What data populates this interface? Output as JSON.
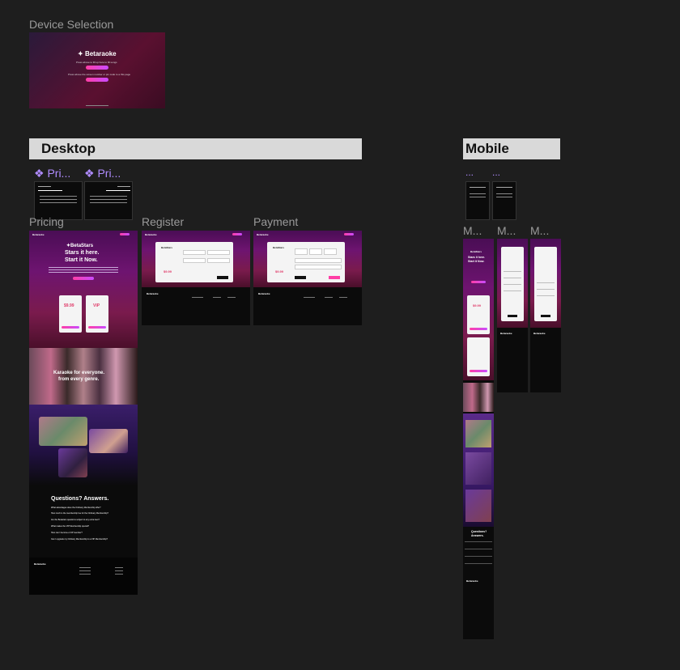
{
  "canvas": {
    "frames": [
      {
        "id": "device",
        "label": "Device Selection"
      },
      {
        "id": "pricing",
        "label": "Pricing"
      },
      {
        "id": "register",
        "label": "Register"
      },
      {
        "id": "payment",
        "label": "Payment"
      }
    ],
    "sections": {
      "desktop": "Desktop",
      "mobile": "Mobile"
    },
    "component_labels": [
      "❖ Pri...",
      "❖ Pri..."
    ],
    "mobile_labels": [
      "...",
      "...",
      "M...",
      "M...",
      "M..."
    ]
  },
  "device": {
    "brand": "Betaraoke",
    "line1": "Press above to fill up here to fill songs",
    "line2": "Press above the screen number or pin code to a this page"
  },
  "pricing": {
    "brand": "Betaraoke",
    "hero_logo": "BetaStars",
    "hero_title_1": "Stars it here.",
    "hero_title_2": "Start it Now.",
    "price_1": "$9.99",
    "price_2": "VIP",
    "tagline_1": "Karaoke for everyone.",
    "tagline_2": "from every genre.",
    "faq_title": "Questions? Answers.",
    "faq": [
      "What advantages does the Ordinary Membership offer?",
      "How much is the membership fee for the Ordinary Membership?",
      "Are the Betastars questions subject to any extra fees?",
      "What makes the VIP Membership special?",
      "How can I become a VIP member?",
      "Can I upgrade my Ordinary Membership to a VIP Membership?"
    ],
    "footer_brand": "Betaraoke"
  },
  "register": {
    "brand": "Betaraoke",
    "card_brand": "BetaStars",
    "price": "$9.99",
    "footer_brand": "Betaraoke"
  },
  "payment": {
    "brand": "Betaraoke",
    "card_brand": "BetaStars",
    "price": "$9.99",
    "footer_brand": "Betaraoke"
  },
  "mobile": {
    "hero_logo": "BetaStars",
    "hero_title_1": "Stars it here.",
    "hero_title_2": "Start it Now.",
    "faq_title_1": "Questions?",
    "faq_title_2": "Answers.",
    "footer_brand": "Betaraoke",
    "price": "$9.99"
  }
}
